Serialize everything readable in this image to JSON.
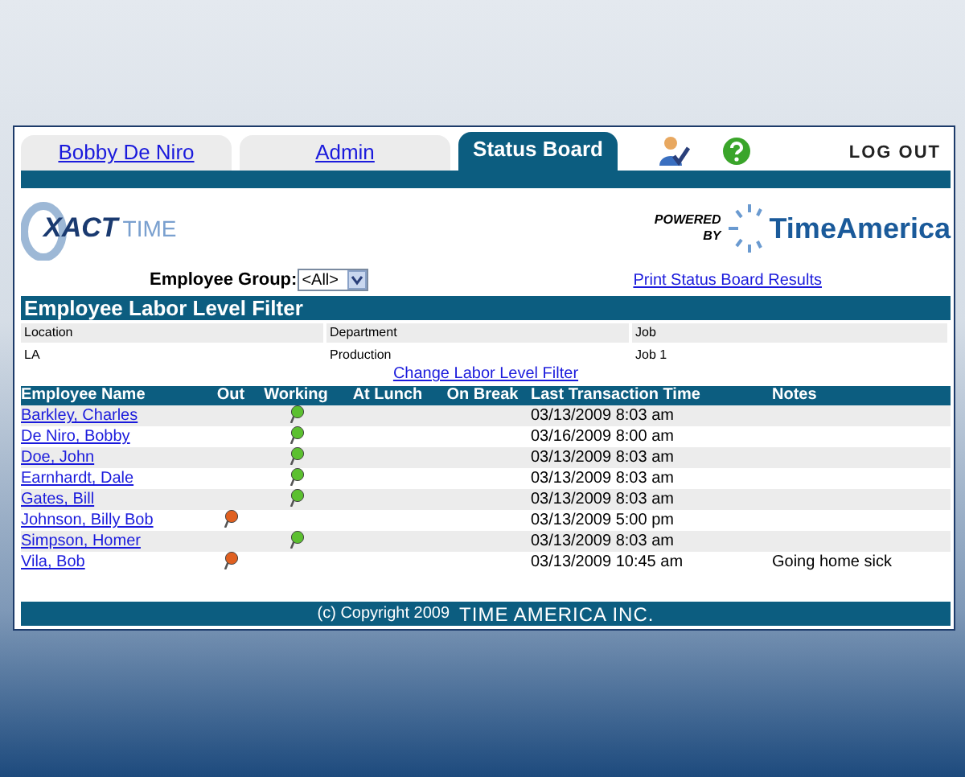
{
  "tabs": [
    {
      "label": "Bobby De Niro",
      "selected": false
    },
    {
      "label": "Admin",
      "selected": false
    },
    {
      "label": "Status Board",
      "selected": true
    }
  ],
  "logout": "LOG OUT",
  "logo": {
    "main": "XACT",
    "sub": "TIME"
  },
  "powered_by": {
    "line1": "POWERED",
    "line2": "BY",
    "brand": "TimeAmerica"
  },
  "employee_group": {
    "label": "Employee Group:",
    "value": "<All>"
  },
  "print_link": "Print Status Board Results",
  "filter": {
    "title": "Employee Labor Level Filter",
    "labels": [
      "Location",
      "Department",
      "Job"
    ],
    "values": [
      "LA",
      "Production",
      "Job 1"
    ],
    "change_link": "Change Labor Level Filter"
  },
  "table": {
    "columns": [
      "Employee Name",
      "Out",
      "Working",
      "At Lunch",
      "On Break",
      "Last Transaction Time",
      "Notes"
    ],
    "rows": [
      {
        "name": "Barkley, Charles",
        "kind": "working",
        "time": "03/13/2009 8:03 am"
      },
      {
        "name": "De Niro, Bobby",
        "kind": "working",
        "time": "03/16/2009 8:00 am"
      },
      {
        "name": "Doe, John",
        "kind": "working",
        "time": "03/13/2009 8:03 am"
      },
      {
        "name": "Earnhardt, Dale",
        "kind": "working",
        "time": "03/13/2009 8:03 am"
      },
      {
        "name": "Gates, Bill",
        "kind": "working",
        "time": "03/13/2009 8:03 am"
      },
      {
        "name": "Johnson, Billy Bob",
        "kind": "out",
        "time": "03/13/2009 5:00 pm"
      },
      {
        "name": "Simpson, Homer",
        "kind": "working",
        "time": "03/13/2009 8:03 am"
      },
      {
        "name": "Vila, Bob",
        "kind": "out",
        "time": "03/13/2009 10:45 am",
        "notes": "Going home sick"
      }
    ]
  },
  "footer": {
    "copyright": "(c) Copyright 2009",
    "company": "TIME AMERICA INC."
  }
}
